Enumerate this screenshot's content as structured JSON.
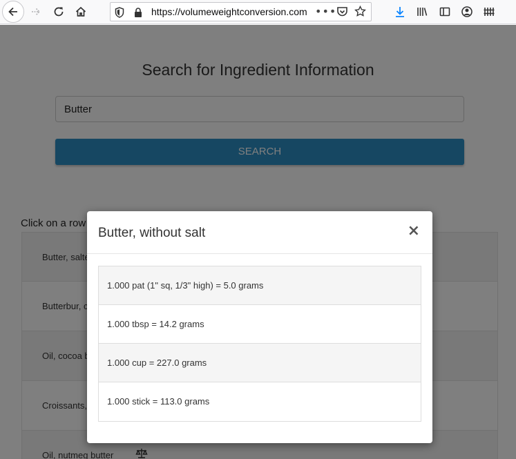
{
  "browser": {
    "url": "https://volumeweightconversion.com",
    "icons": [
      "back-arrow-icon",
      "forward-arrow-icon",
      "reload-icon",
      "home-icon",
      "tracking-shield-icon",
      "lock-icon",
      "page-actions-icon",
      "pocket-icon",
      "bookmark-star-icon",
      "download-icon",
      "library-icon",
      "sidebar-icon",
      "account-icon",
      "extension-icon"
    ],
    "more_glyph": "•••"
  },
  "page": {
    "title": "Search for Ingredient Information",
    "search": {
      "value": "Butter"
    },
    "search_button": "SEARCH",
    "hint": "Click on a row",
    "results": [
      {
        "label": "Butter, salte"
      },
      {
        "label": "Butterbur, c"
      },
      {
        "label": "Oil, cocoa b"
      },
      {
        "label": "Croissants,"
      },
      {
        "label": "Oil, nutmeg butter"
      }
    ]
  },
  "modal": {
    "title": "Butter, without salt",
    "close_label": "×",
    "conversions": [
      {
        "text": "1.000 pat (1\" sq, 1/3\" high) = 5.0 grams"
      },
      {
        "text": "1.000 tbsp = 14.2 grams"
      },
      {
        "text": "1.000 cup = 227.0 grams"
      },
      {
        "text": "1.000 stick = 113.0 grams"
      }
    ]
  },
  "colors": {
    "accent": "#2c8fc4",
    "backdrop": "rgba(0,0,0,0.5)"
  }
}
